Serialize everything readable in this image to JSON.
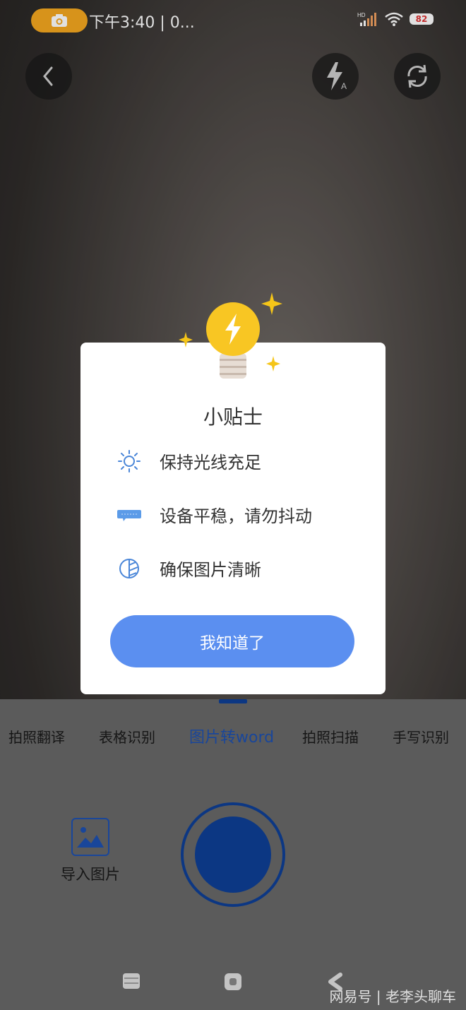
{
  "status_bar": {
    "time": "下午3:40 | 0...",
    "network": "HD",
    "battery": "82"
  },
  "top_controls": {
    "back": "back-arrow-icon",
    "flash": "flash-auto-icon",
    "switch_camera": "switch-camera-icon"
  },
  "dialog": {
    "title": "小贴士",
    "tips": [
      {
        "icon": "sun-icon",
        "text": "保持光线充足"
      },
      {
        "icon": "device-icon",
        "text": "设备平稳，请勿抖动"
      },
      {
        "icon": "clarity-icon",
        "text": "确保图片清晰"
      }
    ],
    "confirm_button": "我知道了"
  },
  "tabs": [
    {
      "label": "拍照翻译"
    },
    {
      "label": "表格识别"
    },
    {
      "label": "图片转word",
      "active": true
    },
    {
      "label": "拍照扫描"
    },
    {
      "label": "手写识别"
    }
  ],
  "import": {
    "label": "导入图片"
  },
  "watermark": "网易号 | 老李头聊车",
  "colors": {
    "accent": "#1d50b0",
    "button": "#5b8ff0",
    "pill": "#f5a81f"
  }
}
